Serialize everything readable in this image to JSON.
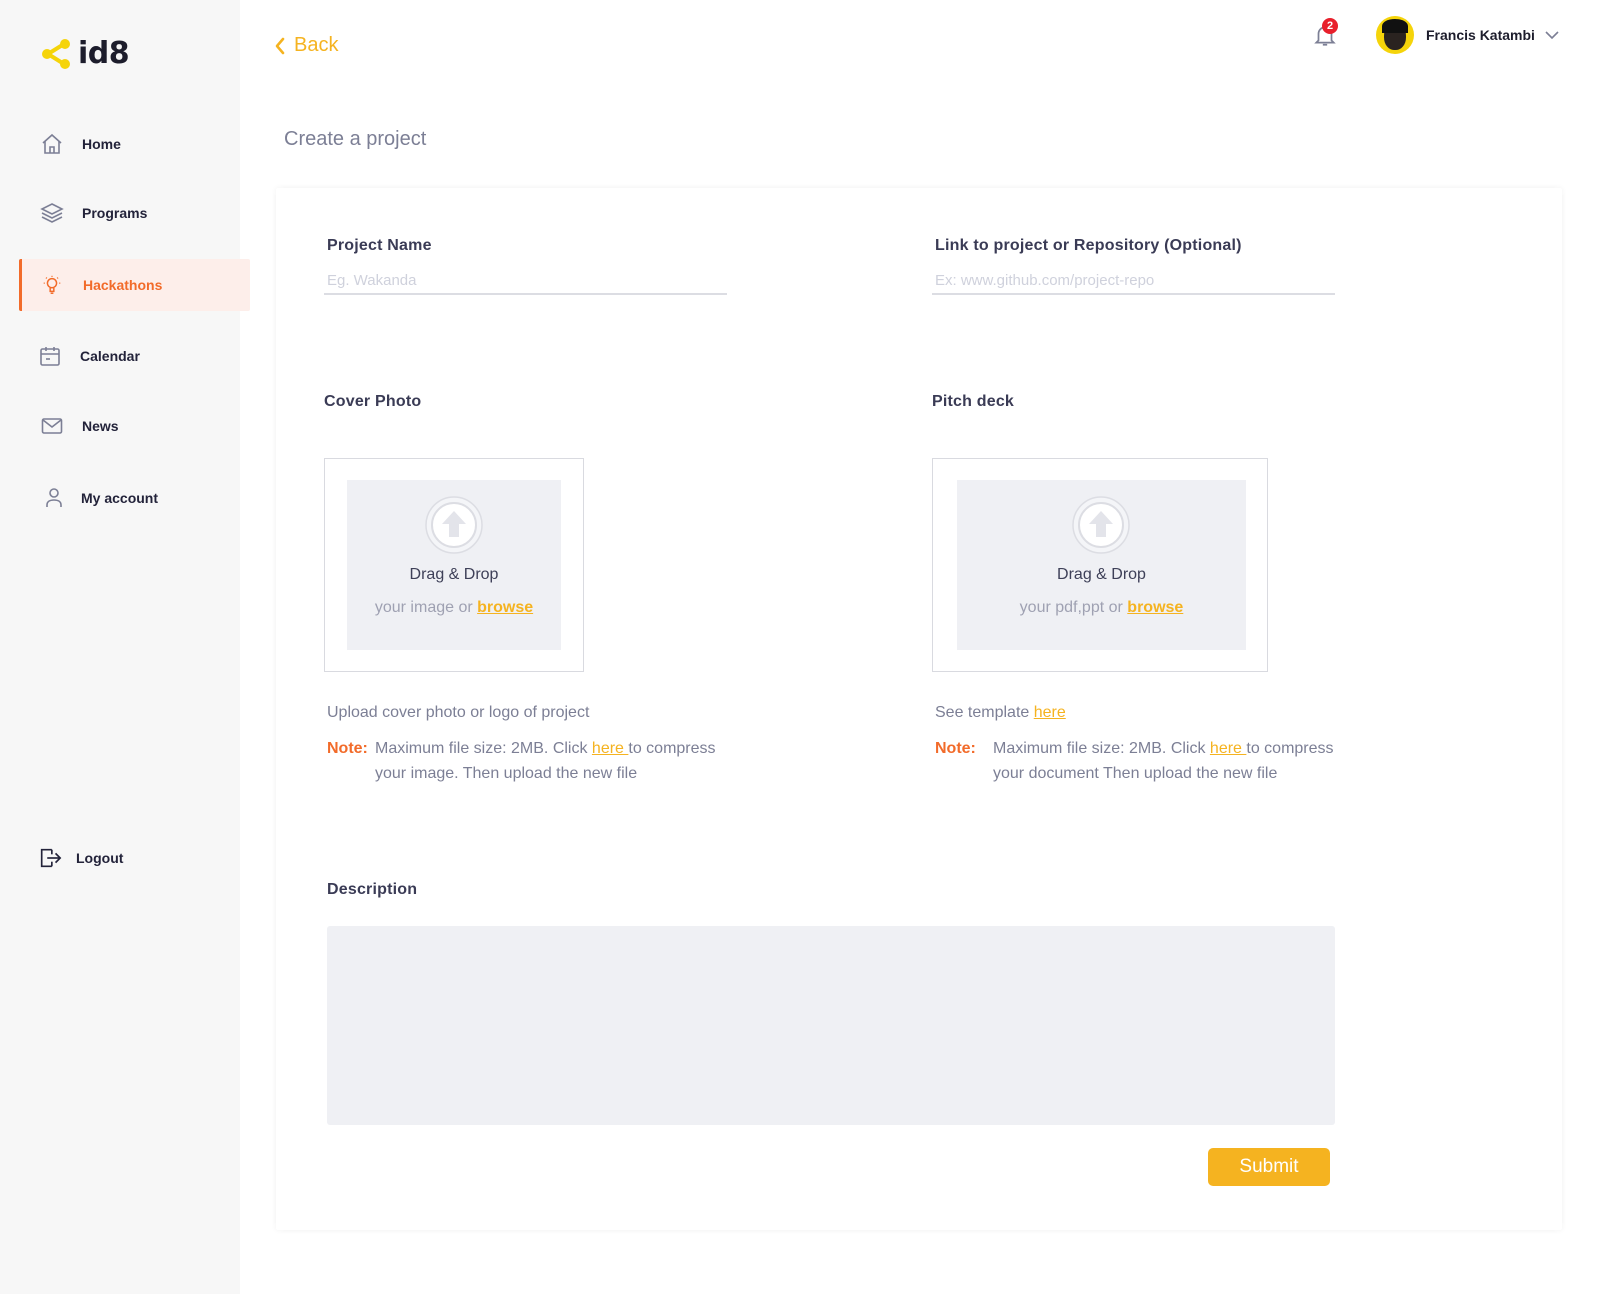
{
  "app": {
    "logo_text": "id8"
  },
  "sidebar": {
    "items": [
      {
        "label": "Home",
        "icon": "home-icon"
      },
      {
        "label": "Programs",
        "icon": "layers-icon"
      },
      {
        "label": "Hackathons",
        "icon": "bulb-icon",
        "active": true
      },
      {
        "label": "Calendar",
        "icon": "calendar-icon"
      },
      {
        "label": "News",
        "icon": "mail-icon"
      },
      {
        "label": "My account",
        "icon": "user-icon"
      }
    ],
    "logout_label": "Logout"
  },
  "header": {
    "back_label": "Back",
    "notifications_count": "2",
    "user_name": "Francis Katambi"
  },
  "page": {
    "title": "Create a project"
  },
  "form": {
    "project_name": {
      "label": "Project Name",
      "placeholder": "Eg. Wakanda",
      "value": ""
    },
    "repo_link": {
      "label": "Link to project or Repository (Optional)",
      "placeholder": "Ex: www.github.com/project-repo",
      "value": ""
    },
    "cover_photo": {
      "label": "Cover Photo",
      "drag_title": "Drag & Drop",
      "drag_sub_prefix": "your image or ",
      "browse_label": "browse",
      "help": "Upload cover photo or logo of project",
      "note_key": "Note:",
      "note_prefix": "Maximum file size: 2MB. Click ",
      "note_link": "here ",
      "note_suffix": "to compress",
      "note_line2": "your image. Then upload the new file"
    },
    "pitch_deck": {
      "label": "Pitch deck",
      "drag_title": "Drag & Drop",
      "drag_sub_prefix": "your pdf,ppt or ",
      "browse_label": "browse",
      "help_prefix": "See template ",
      "help_link": "here",
      "note_key": "Note:",
      "note_prefix": "Maximum file size: 2MB. Click ",
      "note_link": "here ",
      "note_suffix": "to compress",
      "note_line2": "your document Then upload the new file"
    },
    "description": {
      "label": "Description",
      "value": ""
    },
    "submit_label": "Submit"
  },
  "colors": {
    "accent": "#f5b320",
    "active_nav": "#f26b2a",
    "badge": "#e8202c",
    "sidebar_bg": "#f7f7f7",
    "dropzone_bg": "#eff0f4"
  }
}
